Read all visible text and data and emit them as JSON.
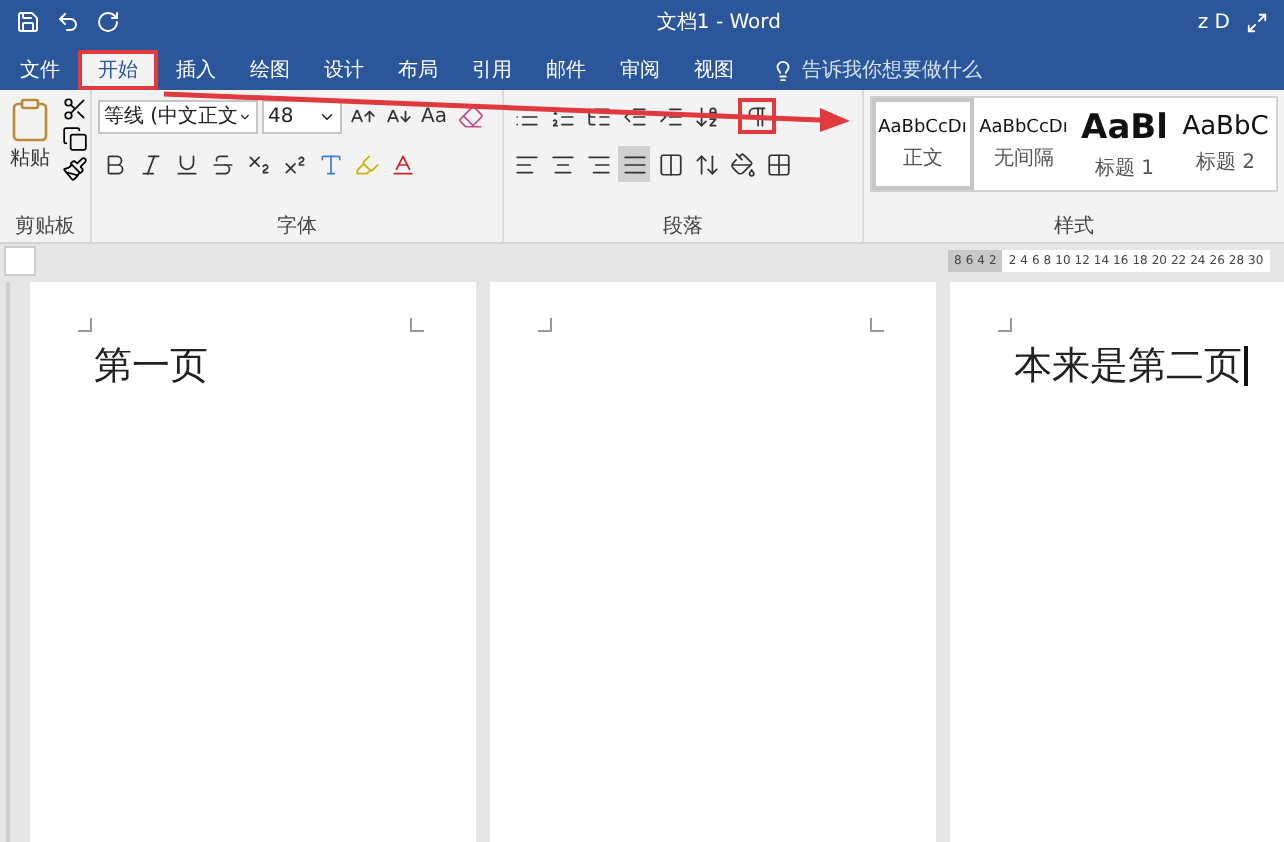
{
  "window": {
    "title": "文档1 - Word",
    "user": "z D"
  },
  "tabs": [
    {
      "label": "文件",
      "selected": false,
      "marked": false
    },
    {
      "label": "开始",
      "selected": true,
      "marked": true
    },
    {
      "label": "插入",
      "selected": false,
      "marked": false
    },
    {
      "label": "绘图",
      "selected": false,
      "marked": false
    },
    {
      "label": "设计",
      "selected": false,
      "marked": false
    },
    {
      "label": "布局",
      "selected": false,
      "marked": false
    },
    {
      "label": "引用",
      "selected": false,
      "marked": false
    },
    {
      "label": "邮件",
      "selected": false,
      "marked": false
    },
    {
      "label": "审阅",
      "selected": false,
      "marked": false
    },
    {
      "label": "视图",
      "selected": false,
      "marked": false
    }
  ],
  "tell_me": {
    "placeholder": "告诉我你想要做什么"
  },
  "ribbon": {
    "clipboard": {
      "paste_label": "粘贴",
      "group_label": "剪贴板"
    },
    "font": {
      "font_name": "等线 (中文正文",
      "font_size": "48",
      "change_case": "Aa",
      "group_label": "字体"
    },
    "paragraph": {
      "group_label": "段落",
      "show_marks_marked": true
    },
    "styles": {
      "group_label": "样式",
      "items": [
        {
          "preview": "AaBbCcDı",
          "name": "正文",
          "kind": "body",
          "selected": true
        },
        {
          "preview": "AaBbCcDı",
          "name": "无间隔",
          "kind": "body",
          "selected": false
        },
        {
          "preview": "AaBl",
          "name": "标题 1",
          "kind": "heading1",
          "selected": false
        },
        {
          "preview": "AaBbC",
          "name": "标题 2",
          "kind": "heading2",
          "selected": false
        }
      ]
    }
  },
  "ruler": {
    "left_numbers": [
      "8",
      "6",
      "4",
      "2"
    ],
    "right_numbers": [
      "2",
      "4",
      "6",
      "8",
      "10",
      "12",
      "14",
      "16",
      "18",
      "20",
      "22",
      "24",
      "26",
      "28",
      "30"
    ]
  },
  "pages": [
    {
      "text": "第一页",
      "cursor": false
    },
    {
      "cursor": false
    },
    {
      "text": "本来是第二页",
      "cursor": true
    }
  ]
}
